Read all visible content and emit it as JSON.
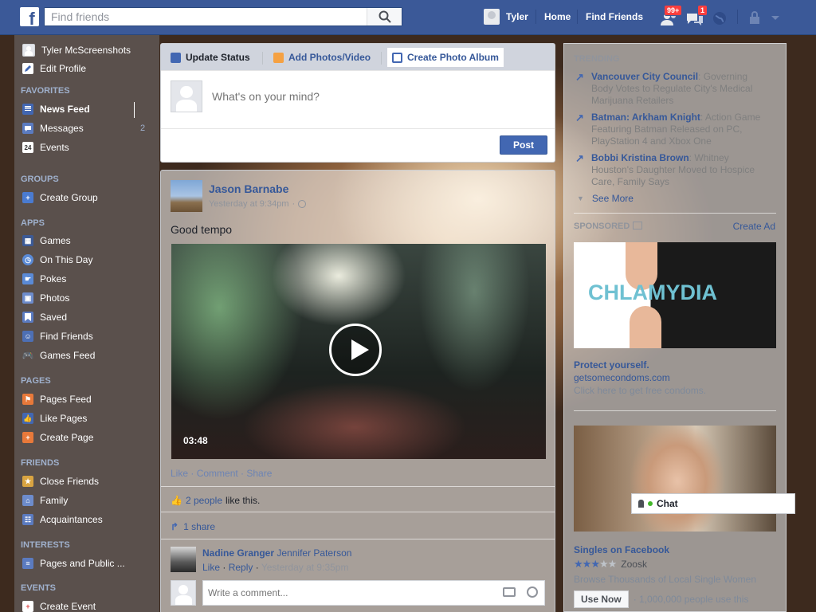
{
  "topbar": {
    "logo": "f",
    "search_placeholder": "Find friends",
    "profile_name": "Tyler",
    "nav_home": "Home",
    "nav_find_friends": "Find Friends",
    "friend_requests_badge": "99+",
    "messages_badge": "1",
    "brand_color": "#3b5998"
  },
  "sidebar": {
    "profile_name": "Tyler McScreenshots",
    "edit_profile": "Edit Profile",
    "favorites_header": "FAVORITES",
    "favorites": [
      {
        "label": "News Feed",
        "icon": "news-feed-icon"
      },
      {
        "label": "Messages",
        "icon": "messages-icon",
        "count": "2"
      },
      {
        "label": "Events",
        "icon": "events-calendar-icon",
        "icon_text": "24"
      }
    ],
    "groups_header": "GROUPS",
    "groups": [
      {
        "label": "Create Group",
        "icon": "create-group-icon"
      }
    ],
    "apps_header": "APPS",
    "apps": [
      {
        "label": "Games",
        "icon": "games-icon"
      },
      {
        "label": "On This Day",
        "icon": "on-this-day-icon"
      },
      {
        "label": "Pokes",
        "icon": "pokes-icon"
      },
      {
        "label": "Photos",
        "icon": "photos-icon"
      },
      {
        "label": "Saved",
        "icon": "saved-bookmark-icon"
      },
      {
        "label": "Find Friends",
        "icon": "find-friends-icon"
      },
      {
        "label": "Games Feed",
        "icon": "games-feed-controller-icon"
      }
    ],
    "pages_header": "PAGES",
    "pages": [
      {
        "label": "Pages Feed",
        "icon": "pages-feed-icon"
      },
      {
        "label": "Like Pages",
        "icon": "like-pages-icon"
      },
      {
        "label": "Create Page",
        "icon": "create-page-icon"
      }
    ],
    "friends_header": "FRIENDS",
    "friends": [
      {
        "label": "Close Friends",
        "icon": "close-friends-icon"
      },
      {
        "label": "Family",
        "icon": "family-icon"
      },
      {
        "label": "Acquaintances",
        "icon": "acquaintances-icon"
      }
    ],
    "interests_header": "INTERESTS",
    "interests": [
      {
        "label": "Pages and Public ...",
        "icon": "pages-public-figures-icon"
      }
    ],
    "events_header": "EVENTS",
    "events": [
      {
        "label": "Create Event",
        "icon": "create-event-icon"
      }
    ]
  },
  "composer": {
    "tab_update_status": "Update Status",
    "tab_add_photos": "Add Photos/Video",
    "tab_create_album": "Create Photo Album",
    "placeholder": "What's on your mind?",
    "post_label": "Post"
  },
  "story": {
    "author": "Jason Barnabe",
    "timestamp": "Yesterday at 9:34pm",
    "text": "Good tempo",
    "video_duration": "03:48",
    "action_like": "Like",
    "action_comment": "Comment",
    "action_share": "Share",
    "likes_link": "2 people",
    "likes_suffix": " like this.",
    "shares": "1 share",
    "comment_author": "Nadine Granger",
    "comment_text": "Jennifer Paterson",
    "comment_like": "Like",
    "comment_reply": "Reply",
    "comment_time": "Yesterday at 9:35pm",
    "comment_placeholder": "Write a comment..."
  },
  "trending": {
    "header": "TRENDING",
    "items": [
      {
        "title": "Vancouver City Council",
        "desc": ": Governing Body Votes to Regulate City's Medical Marijuana Retailers"
      },
      {
        "title": "Batman: Arkham Knight",
        "desc": ": Action Game Featuring Batman Released on PC, PlayStation 4 and Xbox One"
      },
      {
        "title": "Bobbi Kristina Brown",
        "desc": ": Whitney Houston's Daughter Moved to Hospice Care, Family Says"
      }
    ],
    "see_more": "See More"
  },
  "sponsored": {
    "header": "SPONSORED",
    "create_ad": "Create Ad",
    "ad1": {
      "image_text": "CHLAMYDIA",
      "title": "Protect yourself.",
      "url": "getsomecondoms.com",
      "desc": "Click here to get free condoms."
    },
    "ad2": {
      "title": "Singles on Facebook",
      "brand": "Zoosk",
      "rating_stars": 3,
      "rating_max": 5,
      "desc": "Browse Thousands of Local Single Women",
      "cta": "Use Now",
      "social": "· 1,000,000 people use this"
    }
  },
  "chat": {
    "label": "Chat"
  }
}
